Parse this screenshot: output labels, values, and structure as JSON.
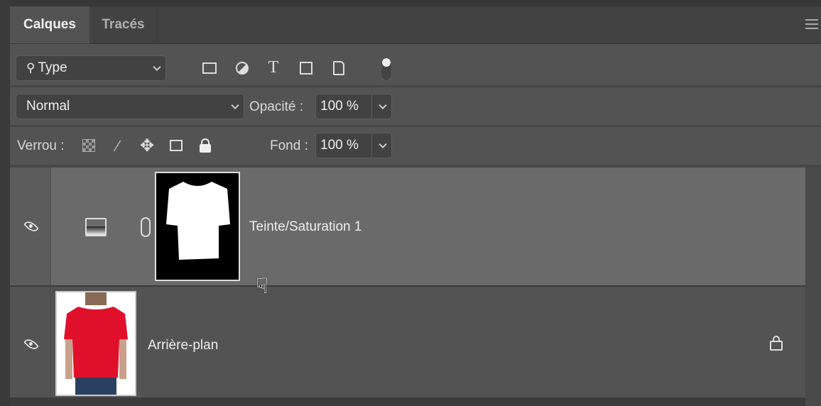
{
  "tabs": [
    {
      "label": "Calques",
      "active": true
    },
    {
      "label": "Tracés",
      "active": false
    }
  ],
  "filter": {
    "label": "Type",
    "icons": [
      "image-filter-icon",
      "adjustment-filter-icon",
      "type-filter-icon",
      "shape-filter-icon",
      "smart-object-filter-icon",
      "filter-toggle-icon"
    ]
  },
  "blend": {
    "mode": "Normal",
    "opacity_label": "Opacité :",
    "opacity": "100 %"
  },
  "lock": {
    "label": "Verrou :",
    "icons": [
      "lock-transparent-icon",
      "lock-paint-icon",
      "lock-position-icon",
      "lock-artboard-icon",
      "lock-all-icon"
    ],
    "fill_label": "Fond :",
    "fill": "100 %"
  },
  "layers": [
    {
      "name": "Teinte/Saturation 1",
      "visible": true,
      "selected": true,
      "type": "adjustment"
    },
    {
      "name": "Arrière-plan",
      "visible": true,
      "locked": true,
      "type": "image"
    }
  ],
  "colors": {
    "shirt": "#e0102a",
    "selected_layer": "#6a6a6a",
    "panel": "#535353"
  }
}
